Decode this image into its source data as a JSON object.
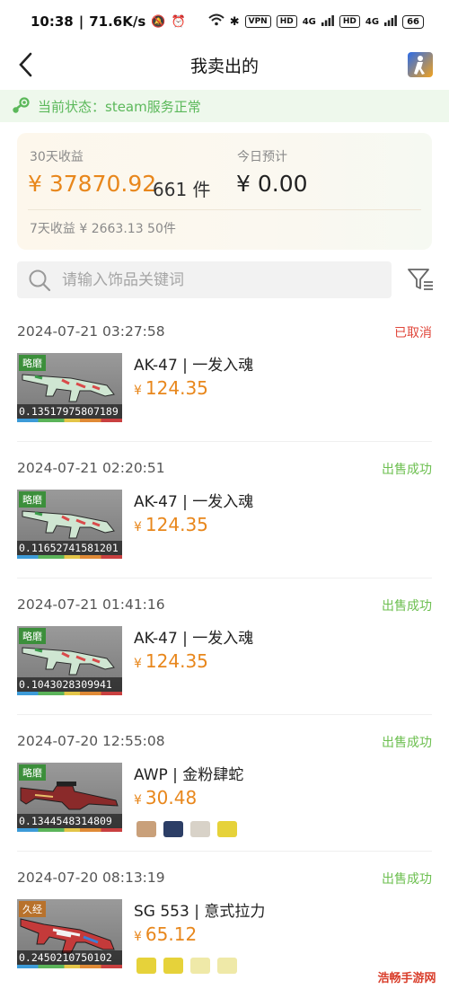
{
  "status_bar": {
    "time": "10:38",
    "net_speed": "71.6K/s",
    "vpn": "VPN",
    "hd1": "HD",
    "sig1": "4G",
    "hd2": "HD",
    "sig2": "4G",
    "battery": "66"
  },
  "nav": {
    "title": "我卖出的"
  },
  "steam": {
    "status": "当前状态：steam服务正常"
  },
  "earnings": {
    "month_label": "30天收益",
    "month_amount": "¥ 37870.92",
    "month_count": "661 件",
    "today_label": "今日预计",
    "today_amount": "¥ 0.00",
    "week": "7天收益 ¥ 2663.13 50件"
  },
  "search": {
    "placeholder": "请输入饰品关键词"
  },
  "orders": [
    {
      "time": "2024-07-21 03:27:58",
      "status": "已取消",
      "status_color": "#e0463a",
      "wear": "略磨",
      "float": "0.13517975807189",
      "name": "AK-47 | 一发入魂",
      "currency": "¥",
      "price": "124.35",
      "weapon": "ak"
    },
    {
      "time": "2024-07-21 02:20:51",
      "status": "出售成功",
      "status_color": "#6cbf4f",
      "wear": "略磨",
      "float": "0.11652741581201",
      "name": "AK-47 | 一发入魂",
      "currency": "¥",
      "price": "124.35",
      "weapon": "ak"
    },
    {
      "time": "2024-07-21 01:41:16",
      "status": "出售成功",
      "status_color": "#6cbf4f",
      "wear": "略磨",
      "float": "0.1043028309941",
      "name": "AK-47 | 一发入魂",
      "currency": "¥",
      "price": "124.35",
      "weapon": "ak"
    },
    {
      "time": "2024-07-20 12:55:08",
      "status": "出售成功",
      "status_color": "#6cbf4f",
      "wear": "略磨",
      "float": "0.1344548314809",
      "name": "AWP | 金粉肆蛇",
      "currency": "¥",
      "price": "30.48",
      "weapon": "awp"
    },
    {
      "time": "2024-07-20 08:13:19",
      "status": "出售成功",
      "status_color": "#6cbf4f",
      "wear": "久经",
      "float": "0.2450210750102",
      "name": "SG 553 | 意式拉力",
      "currency": "¥",
      "price": "65.12",
      "weapon": "sg"
    }
  ],
  "watermark": "浩畅手游网"
}
